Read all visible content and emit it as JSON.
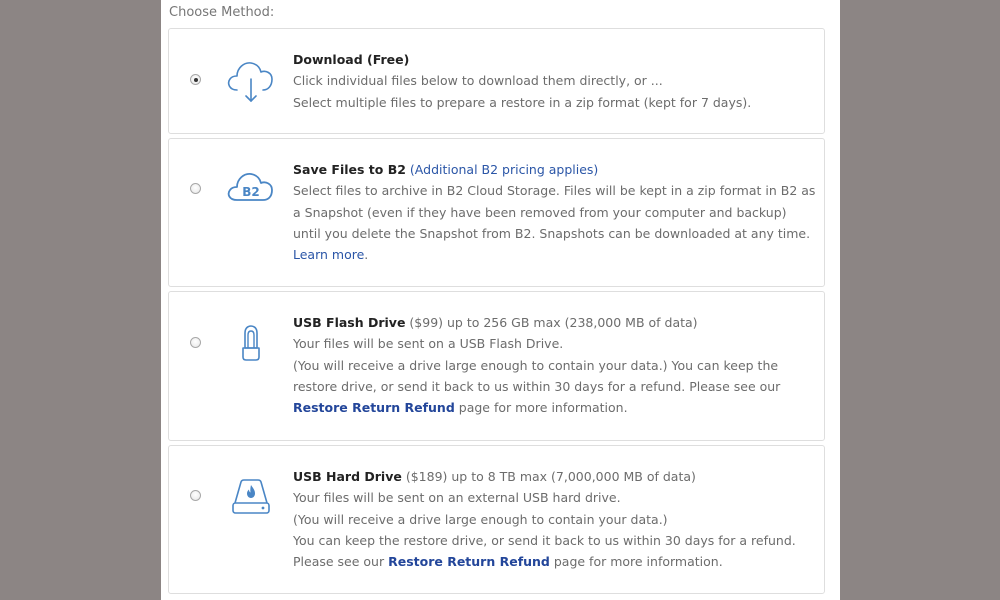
{
  "header": {
    "choose_method": "Choose Method:"
  },
  "options": [
    {
      "title": "Download (Free)",
      "line1": "Click individual files below to download them directly, or ...",
      "line2": "Select multiple files to prepare a restore in a zip format (kept for 7 days)."
    },
    {
      "title": "Save Files to B2",
      "pricing_link": "(Additional B2 pricing applies)",
      "line1": "Select files to archive in B2 Cloud Storage. Files will be kept in a zip format in B2 as",
      "line2": "a Snapshot (even if they have been removed from your computer and backup)",
      "line3": "until you delete the Snapshot from B2. Snapshots can be downloaded at any time.",
      "learn_more": "Learn more",
      "learn_more_suffix": ".",
      "icon_label": "B2"
    },
    {
      "title": "USB Flash Drive",
      "subtitle": " ($99) up to 256 GB max (238,000 MB of data)",
      "line1": "Your files will be sent on a USB Flash Drive.",
      "line2": "(You will receive a drive large enough to contain your data.) You can keep the",
      "line3": "restore drive, or send it back to us within 30 days for a refund. Please see our",
      "refund_link": "Restore Return Refund",
      "line4_suffix": " page for more information."
    },
    {
      "title": "USB Hard Drive",
      "subtitle": " ($189) up to 8 TB max (7,000,000 MB of data)",
      "line1": "Your files will be sent on an external USB hard drive.",
      "line2": "(You will receive a drive large enough to contain your data.)",
      "line3": "You can keep the restore drive, or send it back to us within 30 days for a refund.",
      "line4_prefix": "Please see our ",
      "refund_link": "Restore Return Refund",
      "line4_suffix": " page for more information."
    }
  ],
  "selected_option": "Download (Free)",
  "colors": {
    "accent": "#4a86c5",
    "link": "#2b56a7",
    "background": "#8c8584"
  }
}
